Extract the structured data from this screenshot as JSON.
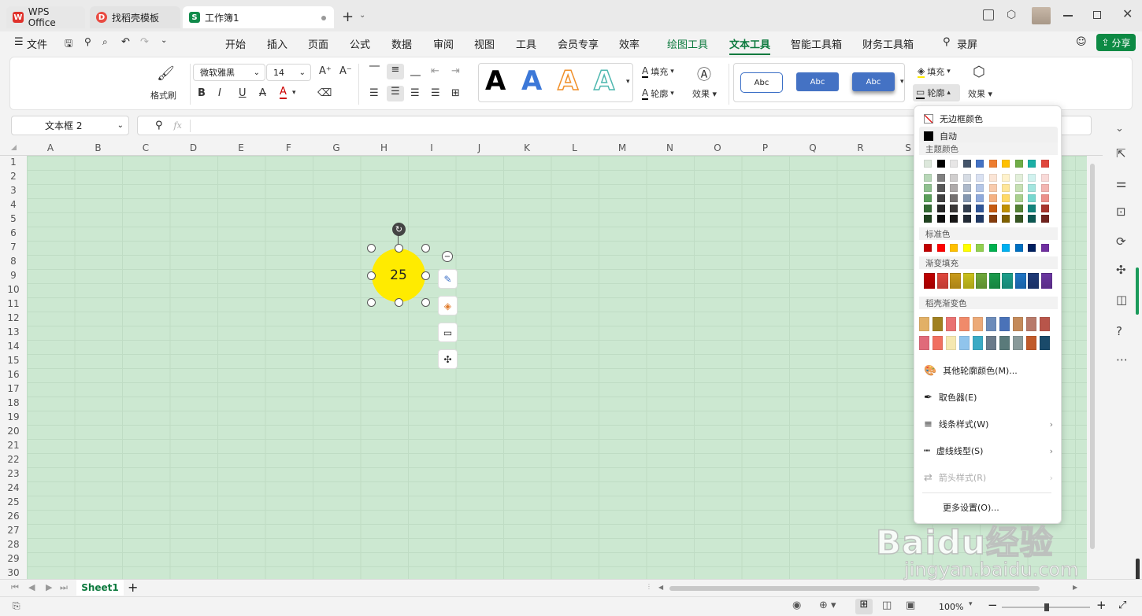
{
  "tabs": [
    {
      "label": "WPS Office",
      "icon": "wps-logo-icon",
      "color": "#e0322c"
    },
    {
      "label": "找稻壳模板",
      "icon": "docer-icon",
      "color": "#e94b42"
    },
    {
      "label": "工作簿1",
      "icon": "spreadsheet-icon",
      "color": "#108a4a"
    }
  ],
  "menubar": {
    "file": "文件",
    "items": [
      "开始",
      "插入",
      "页面",
      "公式",
      "数据",
      "审阅",
      "视图",
      "工具",
      "会员专享",
      "效率",
      "绘图工具",
      "文本工具",
      "智能工具箱",
      "财务工具箱"
    ],
    "active": "文本工具",
    "search": "录屏",
    "share": "分享"
  },
  "ribbon": {
    "format_painter": "格式刷",
    "font_name": "微软雅黑",
    "font_size": "14",
    "wordart_letter": "A",
    "fill": "填充",
    "outline": "轮廓",
    "effect": "效果",
    "style_sample": "Abc",
    "shape_fill": "填充",
    "shape_outline": "轮廓",
    "shape_effect": "效果"
  },
  "formula": {
    "name_box": "文本框 2",
    "fx": "fx"
  },
  "columns": [
    "A",
    "B",
    "C",
    "D",
    "E",
    "F",
    "G",
    "H",
    "I",
    "J",
    "K",
    "L",
    "M",
    "N",
    "O",
    "P",
    "Q",
    "R",
    "S"
  ],
  "rows": [
    "1",
    "2",
    "3",
    "4",
    "5",
    "6",
    "7",
    "8",
    "9",
    "10",
    "11",
    "12",
    "13",
    "14",
    "15",
    "16",
    "17",
    "18",
    "19",
    "20",
    "21",
    "22",
    "23",
    "24",
    "25",
    "26",
    "27",
    "28",
    "29",
    "30"
  ],
  "shape": {
    "text": "25",
    "fill": "#ffeb00"
  },
  "popup": {
    "no_border": "无边框颜色",
    "auto": "自动",
    "theme_colors": "主题颜色",
    "standard_colors": "标准色",
    "gradient_fill": "渐变填充",
    "docer_gradient": "稻壳渐变色",
    "more_colors": "其他轮廓颜色(M)...",
    "eyedropper": "取色器(E)",
    "line_style": "线条样式(W)",
    "dash_style": "虚线线型(S)",
    "arrow_style": "箭头样式(R)",
    "more_settings": "更多设置(O)..."
  },
  "theme_row0": [
    "#dde8dc",
    "#000000",
    "#e7e6e6",
    "#44546a",
    "#4472c4",
    "#ed7d31",
    "#ffc000",
    "#70ad47",
    "#1bafa5",
    "#e0473d"
  ],
  "theme_cols": [
    [
      "#b8d7b8",
      "#8fc08f",
      "#5a9e5a",
      "#346b34",
      "#1f421f"
    ],
    [
      "#808080",
      "#595959",
      "#404040",
      "#262626",
      "#0d0d0d"
    ],
    [
      "#d0cece",
      "#aeaaaa",
      "#757171",
      "#3a3838",
      "#171616"
    ],
    [
      "#d6dce4",
      "#adb9ca",
      "#8497b0",
      "#333f50",
      "#222a35"
    ],
    [
      "#d9e1f2",
      "#b4c6e7",
      "#8ea9db",
      "#2f5597",
      "#1f3864"
    ],
    [
      "#fbe5d6",
      "#f8cbad",
      "#f4b183",
      "#c55a11",
      "#843c0c"
    ],
    [
      "#fff2cc",
      "#ffe699",
      "#ffd966",
      "#bf9000",
      "#7f6000"
    ],
    [
      "#e2efda",
      "#c6e0b4",
      "#a9d08e",
      "#548235",
      "#375623"
    ],
    [
      "#d1f2ef",
      "#a3e5df",
      "#76d7cf",
      "#13837c",
      "#0c5752"
    ],
    [
      "#f9dad8",
      "#f3b5b1",
      "#ec908a",
      "#a8342c",
      "#70221d"
    ]
  ],
  "standard_colors_list": [
    "#c00000",
    "#ff0000",
    "#ffc000",
    "#ffff00",
    "#92d050",
    "#00b050",
    "#00b0f0",
    "#0070c0",
    "#002060",
    "#7030a0"
  ],
  "gradient_list": [
    "#c00000",
    "#e0463c",
    "#c99a1a",
    "#c9c01a",
    "#6ea83a",
    "#1b9b4c",
    "#1b9e8a",
    "#1f74c4",
    "#1e3a78",
    "#6a36a0"
  ],
  "docer_row1": [
    "#e2b066",
    "#a08020",
    "#e97272",
    "#f08a6a",
    "#ecaa78",
    "#6d8cba",
    "#4a72b8",
    "#c48a5a",
    "#b87a6a",
    "#b8554a"
  ],
  "docer_row2": [
    "#e06a7a",
    "#f07060",
    "#f5e8b0",
    "#90c4ec",
    "#3aaac4",
    "#6a7a8a",
    "#5a7a7a",
    "#8a9a9a",
    "#c05a2a",
    "#1a4a6a"
  ],
  "sheet": {
    "name": "Sheet1"
  },
  "status": {
    "zoom": "100%"
  },
  "watermark": {
    "line1": "Baidu经验",
    "line2": "jingyan.baidu.com"
  }
}
